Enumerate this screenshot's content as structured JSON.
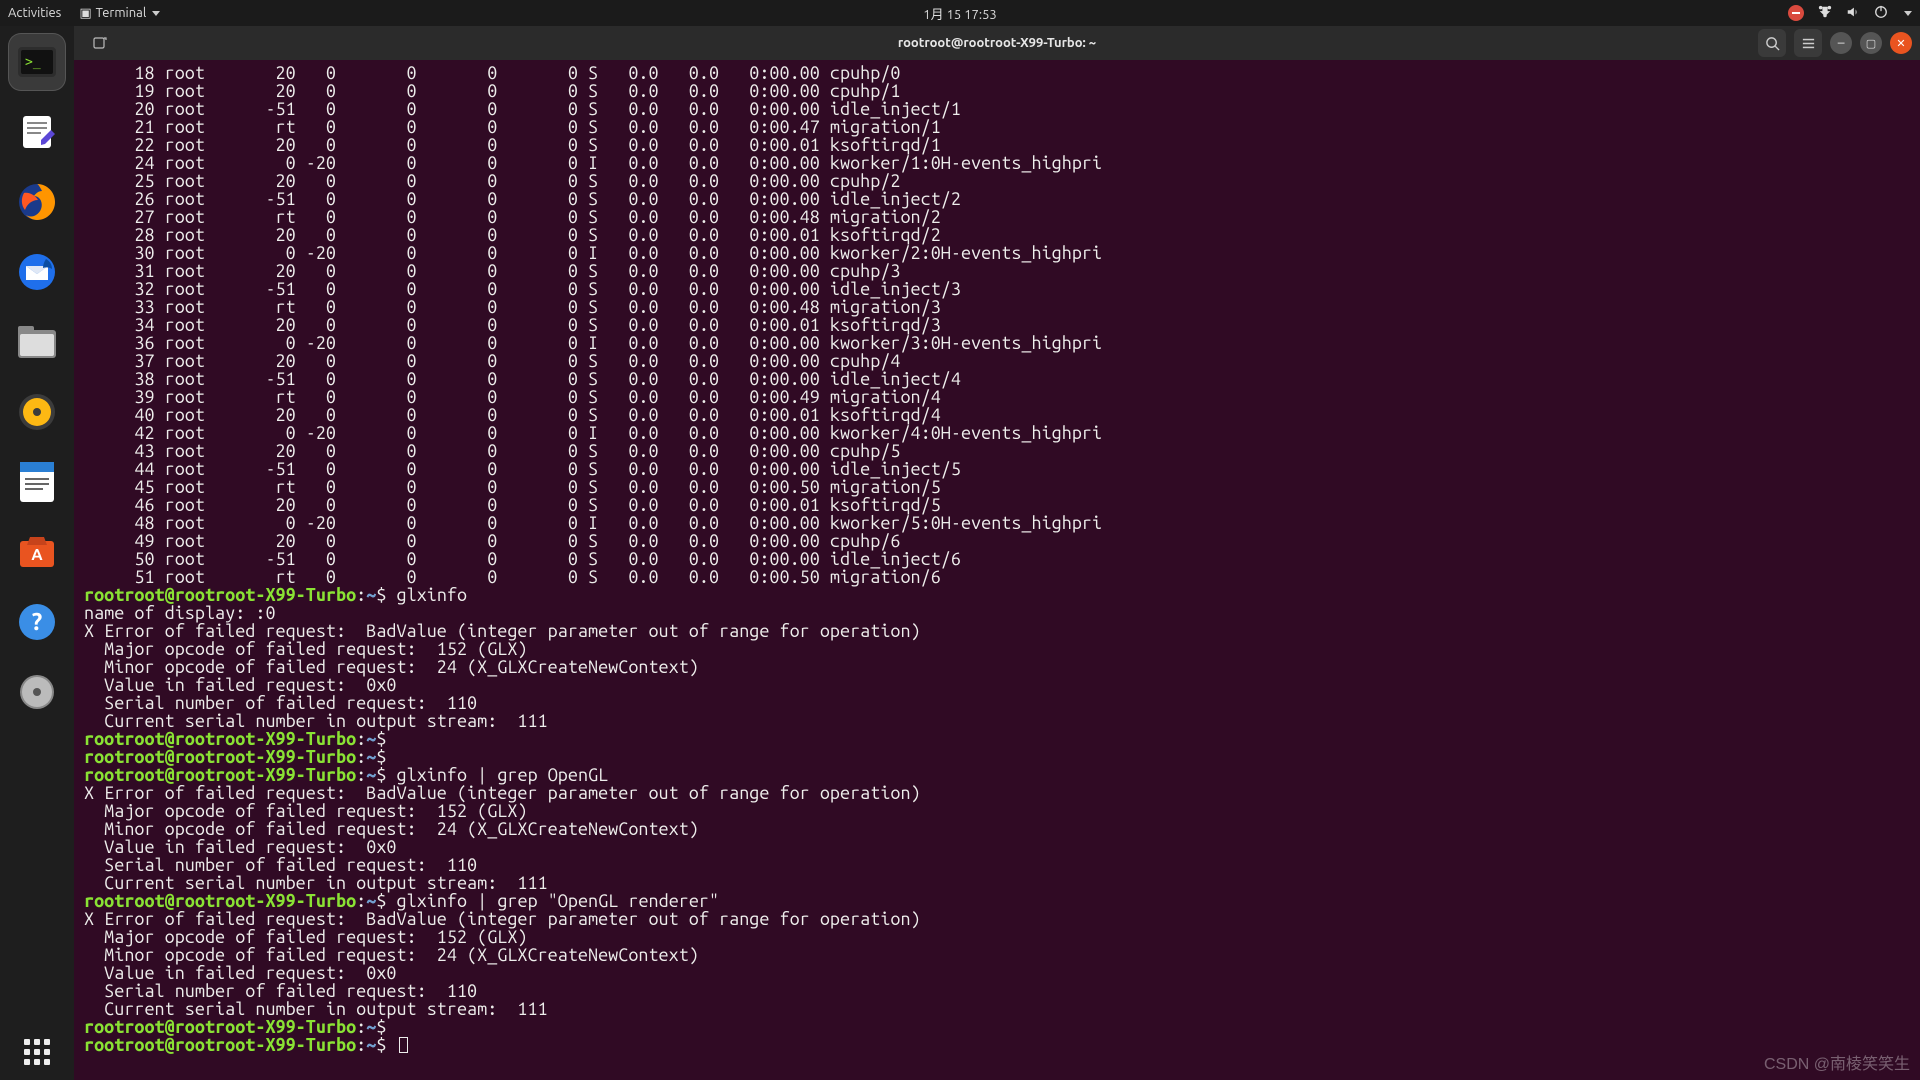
{
  "topbar": {
    "activities": "Activities",
    "app_menu": "Terminal",
    "clock": "1月 15  17:53"
  },
  "dock": {
    "items": [
      {
        "name": "terminal",
        "active": true
      },
      {
        "name": "text-editor"
      },
      {
        "name": "firefox"
      },
      {
        "name": "thunderbird"
      },
      {
        "name": "files"
      },
      {
        "name": "rhythmbox"
      },
      {
        "name": "libreoffice-writer"
      },
      {
        "name": "ubuntu-software"
      },
      {
        "name": "help"
      },
      {
        "name": "disk-utility"
      }
    ]
  },
  "window": {
    "title": "rootroot@rootroot-X99-Turbo: ~"
  },
  "prompt": {
    "userhost": "rootroot@rootroot-X99-Turbo",
    "path": "~",
    "sep": ":",
    "dollar": "$"
  },
  "commands": {
    "c1": "glxinfo",
    "c2": "glxinfo | grep OpenGL",
    "c3": "glxinfo | grep \"OpenGL renderer\""
  },
  "glx_error": {
    "l0": "name of display: :0",
    "l1": "X Error of failed request:  BadValue (integer parameter out of range for operation)",
    "l2": "  Major opcode of failed request:  152 (GLX)",
    "l3": "  Minor opcode of failed request:  24 (X_GLXCreateNewContext)",
    "l4": "  Value in failed request:  0x0",
    "l5": "  Serial number of failed request:  110",
    "l6": "  Current serial number in output stream:  111"
  },
  "top_rows": [
    {
      "pid": "18",
      "user": "root",
      "pr": "20",
      "ni": "0",
      "virt": "0",
      "res": "0",
      "shr": "0",
      "s": "S",
      "cpu": "0.0",
      "mem": "0.0",
      "time": "0:00.00",
      "cmd": "cpuhp/0"
    },
    {
      "pid": "19",
      "user": "root",
      "pr": "20",
      "ni": "0",
      "virt": "0",
      "res": "0",
      "shr": "0",
      "s": "S",
      "cpu": "0.0",
      "mem": "0.0",
      "time": "0:00.00",
      "cmd": "cpuhp/1"
    },
    {
      "pid": "20",
      "user": "root",
      "pr": "-51",
      "ni": "0",
      "virt": "0",
      "res": "0",
      "shr": "0",
      "s": "S",
      "cpu": "0.0",
      "mem": "0.0",
      "time": "0:00.00",
      "cmd": "idle_inject/1"
    },
    {
      "pid": "21",
      "user": "root",
      "pr": "rt",
      "ni": "0",
      "virt": "0",
      "res": "0",
      "shr": "0",
      "s": "S",
      "cpu": "0.0",
      "mem": "0.0",
      "time": "0:00.47",
      "cmd": "migration/1"
    },
    {
      "pid": "22",
      "user": "root",
      "pr": "20",
      "ni": "0",
      "virt": "0",
      "res": "0",
      "shr": "0",
      "s": "S",
      "cpu": "0.0",
      "mem": "0.0",
      "time": "0:00.01",
      "cmd": "ksoftirqd/1"
    },
    {
      "pid": "24",
      "user": "root",
      "pr": "0",
      "ni": "-20",
      "virt": "0",
      "res": "0",
      "shr": "0",
      "s": "I",
      "cpu": "0.0",
      "mem": "0.0",
      "time": "0:00.00",
      "cmd": "kworker/1:0H-events_highpri"
    },
    {
      "pid": "25",
      "user": "root",
      "pr": "20",
      "ni": "0",
      "virt": "0",
      "res": "0",
      "shr": "0",
      "s": "S",
      "cpu": "0.0",
      "mem": "0.0",
      "time": "0:00.00",
      "cmd": "cpuhp/2"
    },
    {
      "pid": "26",
      "user": "root",
      "pr": "-51",
      "ni": "0",
      "virt": "0",
      "res": "0",
      "shr": "0",
      "s": "S",
      "cpu": "0.0",
      "mem": "0.0",
      "time": "0:00.00",
      "cmd": "idle_inject/2"
    },
    {
      "pid": "27",
      "user": "root",
      "pr": "rt",
      "ni": "0",
      "virt": "0",
      "res": "0",
      "shr": "0",
      "s": "S",
      "cpu": "0.0",
      "mem": "0.0",
      "time": "0:00.48",
      "cmd": "migration/2"
    },
    {
      "pid": "28",
      "user": "root",
      "pr": "20",
      "ni": "0",
      "virt": "0",
      "res": "0",
      "shr": "0",
      "s": "S",
      "cpu": "0.0",
      "mem": "0.0",
      "time": "0:00.01",
      "cmd": "ksoftirqd/2"
    },
    {
      "pid": "30",
      "user": "root",
      "pr": "0",
      "ni": "-20",
      "virt": "0",
      "res": "0",
      "shr": "0",
      "s": "I",
      "cpu": "0.0",
      "mem": "0.0",
      "time": "0:00.00",
      "cmd": "kworker/2:0H-events_highpri"
    },
    {
      "pid": "31",
      "user": "root",
      "pr": "20",
      "ni": "0",
      "virt": "0",
      "res": "0",
      "shr": "0",
      "s": "S",
      "cpu": "0.0",
      "mem": "0.0",
      "time": "0:00.00",
      "cmd": "cpuhp/3"
    },
    {
      "pid": "32",
      "user": "root",
      "pr": "-51",
      "ni": "0",
      "virt": "0",
      "res": "0",
      "shr": "0",
      "s": "S",
      "cpu": "0.0",
      "mem": "0.0",
      "time": "0:00.00",
      "cmd": "idle_inject/3"
    },
    {
      "pid": "33",
      "user": "root",
      "pr": "rt",
      "ni": "0",
      "virt": "0",
      "res": "0",
      "shr": "0",
      "s": "S",
      "cpu": "0.0",
      "mem": "0.0",
      "time": "0:00.48",
      "cmd": "migration/3"
    },
    {
      "pid": "34",
      "user": "root",
      "pr": "20",
      "ni": "0",
      "virt": "0",
      "res": "0",
      "shr": "0",
      "s": "S",
      "cpu": "0.0",
      "mem": "0.0",
      "time": "0:00.01",
      "cmd": "ksoftirqd/3"
    },
    {
      "pid": "36",
      "user": "root",
      "pr": "0",
      "ni": "-20",
      "virt": "0",
      "res": "0",
      "shr": "0",
      "s": "I",
      "cpu": "0.0",
      "mem": "0.0",
      "time": "0:00.00",
      "cmd": "kworker/3:0H-events_highpri"
    },
    {
      "pid": "37",
      "user": "root",
      "pr": "20",
      "ni": "0",
      "virt": "0",
      "res": "0",
      "shr": "0",
      "s": "S",
      "cpu": "0.0",
      "mem": "0.0",
      "time": "0:00.00",
      "cmd": "cpuhp/4"
    },
    {
      "pid": "38",
      "user": "root",
      "pr": "-51",
      "ni": "0",
      "virt": "0",
      "res": "0",
      "shr": "0",
      "s": "S",
      "cpu": "0.0",
      "mem": "0.0",
      "time": "0:00.00",
      "cmd": "idle_inject/4"
    },
    {
      "pid": "39",
      "user": "root",
      "pr": "rt",
      "ni": "0",
      "virt": "0",
      "res": "0",
      "shr": "0",
      "s": "S",
      "cpu": "0.0",
      "mem": "0.0",
      "time": "0:00.49",
      "cmd": "migration/4"
    },
    {
      "pid": "40",
      "user": "root",
      "pr": "20",
      "ni": "0",
      "virt": "0",
      "res": "0",
      "shr": "0",
      "s": "S",
      "cpu": "0.0",
      "mem": "0.0",
      "time": "0:00.01",
      "cmd": "ksoftirqd/4"
    },
    {
      "pid": "42",
      "user": "root",
      "pr": "0",
      "ni": "-20",
      "virt": "0",
      "res": "0",
      "shr": "0",
      "s": "I",
      "cpu": "0.0",
      "mem": "0.0",
      "time": "0:00.00",
      "cmd": "kworker/4:0H-events_highpri"
    },
    {
      "pid": "43",
      "user": "root",
      "pr": "20",
      "ni": "0",
      "virt": "0",
      "res": "0",
      "shr": "0",
      "s": "S",
      "cpu": "0.0",
      "mem": "0.0",
      "time": "0:00.00",
      "cmd": "cpuhp/5"
    },
    {
      "pid": "44",
      "user": "root",
      "pr": "-51",
      "ni": "0",
      "virt": "0",
      "res": "0",
      "shr": "0",
      "s": "S",
      "cpu": "0.0",
      "mem": "0.0",
      "time": "0:00.00",
      "cmd": "idle_inject/5"
    },
    {
      "pid": "45",
      "user": "root",
      "pr": "rt",
      "ni": "0",
      "virt": "0",
      "res": "0",
      "shr": "0",
      "s": "S",
      "cpu": "0.0",
      "mem": "0.0",
      "time": "0:00.50",
      "cmd": "migration/5"
    },
    {
      "pid": "46",
      "user": "root",
      "pr": "20",
      "ni": "0",
      "virt": "0",
      "res": "0",
      "shr": "0",
      "s": "S",
      "cpu": "0.0",
      "mem": "0.0",
      "time": "0:00.01",
      "cmd": "ksoftirqd/5"
    },
    {
      "pid": "48",
      "user": "root",
      "pr": "0",
      "ni": "-20",
      "virt": "0",
      "res": "0",
      "shr": "0",
      "s": "I",
      "cpu": "0.0",
      "mem": "0.0",
      "time": "0:00.00",
      "cmd": "kworker/5:0H-events_highpri"
    },
    {
      "pid": "49",
      "user": "root",
      "pr": "20",
      "ni": "0",
      "virt": "0",
      "res": "0",
      "shr": "0",
      "s": "S",
      "cpu": "0.0",
      "mem": "0.0",
      "time": "0:00.00",
      "cmd": "cpuhp/6"
    },
    {
      "pid": "50",
      "user": "root",
      "pr": "-51",
      "ni": "0",
      "virt": "0",
      "res": "0",
      "shr": "0",
      "s": "S",
      "cpu": "0.0",
      "mem": "0.0",
      "time": "0:00.00",
      "cmd": "idle_inject/6"
    },
    {
      "pid": "51",
      "user": "root",
      "pr": "rt",
      "ni": "0",
      "virt": "0",
      "res": "0",
      "shr": "0",
      "s": "S",
      "cpu": "0.0",
      "mem": "0.0",
      "time": "0:00.50",
      "cmd": "migration/6"
    }
  ],
  "watermark": "CSDN @南棱笑笑生"
}
